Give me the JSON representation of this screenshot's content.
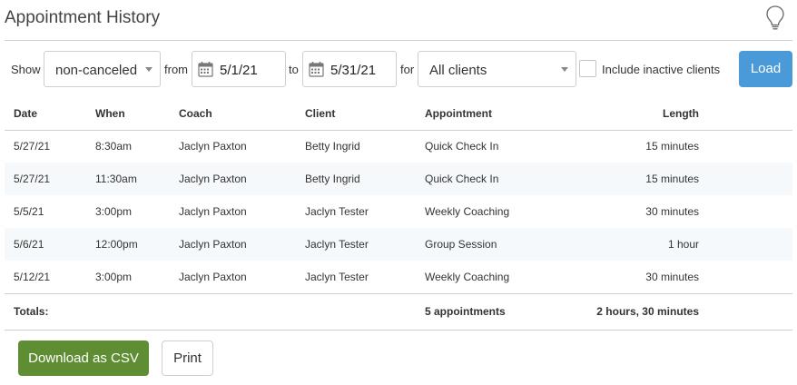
{
  "header": {
    "title": "Appointment History",
    "help_icon": "lightbulb-icon"
  },
  "filters": {
    "show_label": "Show",
    "status_value": "non-canceled",
    "from_label": "from",
    "from_date": "5/1/21",
    "to_label": "to",
    "to_date": "5/31/21",
    "for_label": "for",
    "client_value": "All clients",
    "inactive_label": "Include inactive clients",
    "inactive_checked": false,
    "load_label": "Load"
  },
  "table": {
    "headers": {
      "date": "Date",
      "when": "When",
      "coach": "Coach",
      "client": "Client",
      "appointment": "Appointment",
      "length": "Length"
    },
    "rows": [
      {
        "date": "5/27/21",
        "when": "8:30am",
        "coach": "Jaclyn Paxton",
        "client": "Betty Ingrid",
        "appointment": "Quick Check In",
        "length": "15 minutes"
      },
      {
        "date": "5/27/21",
        "when": "11:30am",
        "coach": "Jaclyn Paxton",
        "client": "Betty Ingrid",
        "appointment": "Quick Check In",
        "length": "15 minutes"
      },
      {
        "date": "5/5/21",
        "when": "3:00pm",
        "coach": "Jaclyn Paxton",
        "client": "Jaclyn Tester",
        "appointment": "Weekly Coaching",
        "length": "30 minutes"
      },
      {
        "date": "5/6/21",
        "when": "12:00pm",
        "coach": "Jaclyn Paxton",
        "client": "Jaclyn Tester",
        "appointment": "Group Session",
        "length": "1 hour"
      },
      {
        "date": "5/12/21",
        "when": "3:00pm",
        "coach": "Jaclyn Paxton",
        "client": "Jaclyn Tester",
        "appointment": "Weekly Coaching",
        "length": "30 minutes"
      }
    ],
    "totals": {
      "label": "Totals:",
      "appointments": "5 appointments",
      "length": "2 hours, 30 minutes"
    }
  },
  "actions": {
    "csv_label": "Download as CSV",
    "print_label": "Print"
  },
  "colors": {
    "primary": "#4a99d8",
    "success": "#5e8d34",
    "row_alt": "#f6f9fc",
    "border": "#cfcfcf"
  }
}
